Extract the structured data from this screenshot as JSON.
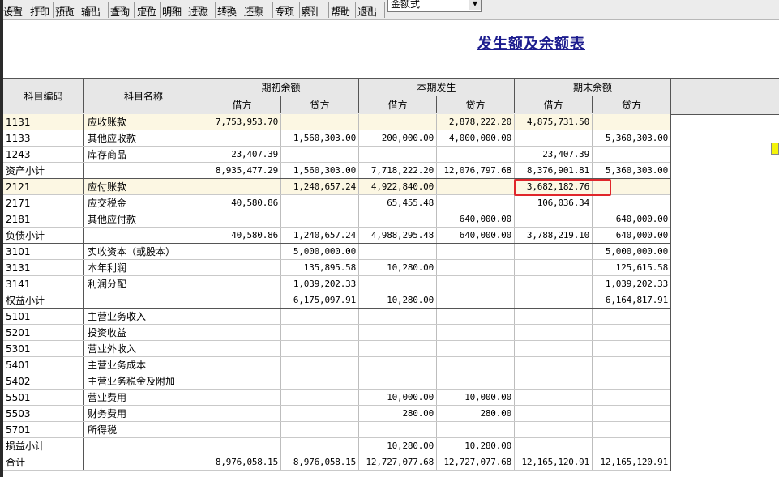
{
  "toolbar": {
    "buttons": [
      {
        "label": "设置",
        "icon": "settings-icon"
      },
      {
        "label": "打印",
        "icon": "print-icon"
      },
      {
        "label": "预览",
        "icon": "preview-icon"
      },
      {
        "label": "输出",
        "icon": "export-icon"
      },
      {
        "label": "查询",
        "icon": "query-icon"
      },
      {
        "label": "定位",
        "icon": "locate-icon"
      },
      {
        "label": "明细",
        "icon": "detail-icon"
      },
      {
        "label": "过滤",
        "icon": "filter-icon"
      },
      {
        "label": "转换",
        "icon": "convert-icon"
      },
      {
        "label": "还原",
        "icon": "restore-icon"
      },
      {
        "label": "专项",
        "icon": "special-icon"
      },
      {
        "label": "累计",
        "icon": "cumulative-icon"
      },
      {
        "label": "帮助",
        "icon": "help-icon"
      },
      {
        "label": "退出",
        "icon": "exit-icon"
      }
    ],
    "format_select": {
      "value": "金额式"
    }
  },
  "report": {
    "title": "发生额及余额表",
    "headers": {
      "code": "科目编码",
      "name": "科目名称",
      "opening": "期初余额",
      "current": "本期发生",
      "closing": "期末余额",
      "debit": "借方",
      "credit": "贷方"
    },
    "rows": [
      {
        "code": "1131",
        "name": "应收账款",
        "v": [
          "7,753,953.70",
          "",
          "",
          "2,878,222.20",
          "4,875,731.50",
          ""
        ],
        "hl": true
      },
      {
        "code": "1133",
        "name": "其他应收款",
        "v": [
          "",
          "1,560,303.00",
          "200,000.00",
          "4,000,000.00",
          "",
          "5,360,303.00"
        ]
      },
      {
        "code": "1243",
        "name": "库存商品",
        "v": [
          "23,407.39",
          "",
          "",
          "",
          "23,407.39",
          ""
        ]
      },
      {
        "code": "资产小计",
        "name": "",
        "v": [
          "8,935,477.29",
          "1,560,303.00",
          "7,718,222.20",
          "12,076,797.68",
          "8,376,901.81",
          "5,360,303.00"
        ]
      },
      {
        "code": "2121",
        "name": "应付账款",
        "v": [
          "",
          "1,240,657.24",
          "4,922,840.00",
          "",
          "3,682,182.76",
          ""
        ],
        "hl": true
      },
      {
        "code": "2171",
        "name": "应交税金",
        "v": [
          "40,580.86",
          "",
          "65,455.48",
          "",
          "106,036.34",
          ""
        ]
      },
      {
        "code": "2181",
        "name": "其他应付款",
        "v": [
          "",
          "",
          "",
          "640,000.00",
          "",
          "640,000.00"
        ]
      },
      {
        "code": "负债小计",
        "name": "",
        "v": [
          "40,580.86",
          "1,240,657.24",
          "4,988,295.48",
          "640,000.00",
          "3,788,219.10",
          "640,000.00"
        ]
      },
      {
        "code": "3101",
        "name": "实收资本（或股本）",
        "v": [
          "",
          "5,000,000.00",
          "",
          "",
          "",
          "5,000,000.00"
        ]
      },
      {
        "code": "3131",
        "name": "本年利润",
        "v": [
          "",
          "135,895.58",
          "10,280.00",
          "",
          "",
          "125,615.58"
        ]
      },
      {
        "code": "3141",
        "name": "利润分配",
        "v": [
          "",
          "1,039,202.33",
          "",
          "",
          "",
          "1,039,202.33"
        ]
      },
      {
        "code": "权益小计",
        "name": "",
        "v": [
          "",
          "6,175,097.91",
          "10,280.00",
          "",
          "",
          "6,164,817.91"
        ]
      },
      {
        "code": "5101",
        "name": "主营业务收入",
        "v": [
          "",
          "",
          "",
          "",
          "",
          ""
        ]
      },
      {
        "code": "5201",
        "name": "投资收益",
        "v": [
          "",
          "",
          "",
          "",
          "",
          ""
        ]
      },
      {
        "code": "5301",
        "name": "营业外收入",
        "v": [
          "",
          "",
          "",
          "",
          "",
          ""
        ]
      },
      {
        "code": "5401",
        "name": "主营业务成本",
        "v": [
          "",
          "",
          "",
          "",
          "",
          ""
        ]
      },
      {
        "code": "5402",
        "name": "主营业务税金及附加",
        "v": [
          "",
          "",
          "",
          "",
          "",
          ""
        ]
      },
      {
        "code": "5501",
        "name": "营业费用",
        "v": [
          "",
          "",
          "10,000.00",
          "10,000.00",
          "",
          ""
        ]
      },
      {
        "code": "5503",
        "name": "财务费用",
        "v": [
          "",
          "",
          "280.00",
          "280.00",
          "",
          ""
        ]
      },
      {
        "code": "5701",
        "name": "所得税",
        "v": [
          "",
          "",
          "",
          "",
          "",
          ""
        ]
      },
      {
        "code": "损益小计",
        "name": "",
        "v": [
          "",
          "",
          "10,280.00",
          "10,280.00",
          "",
          ""
        ]
      },
      {
        "code": "合计",
        "name": "",
        "v": [
          "8,976,058.15",
          "8,976,058.15",
          "12,727,077.68",
          "12,727,077.68",
          "12,165,120.91",
          "12,165,120.91"
        ]
      }
    ]
  },
  "colors": {
    "title": "#1c1c8e",
    "highlight_box": "#e0262b",
    "row_highlight": "#fcf7e3",
    "header_bg": "#e7e7e7",
    "marker": "#f4f40a"
  }
}
